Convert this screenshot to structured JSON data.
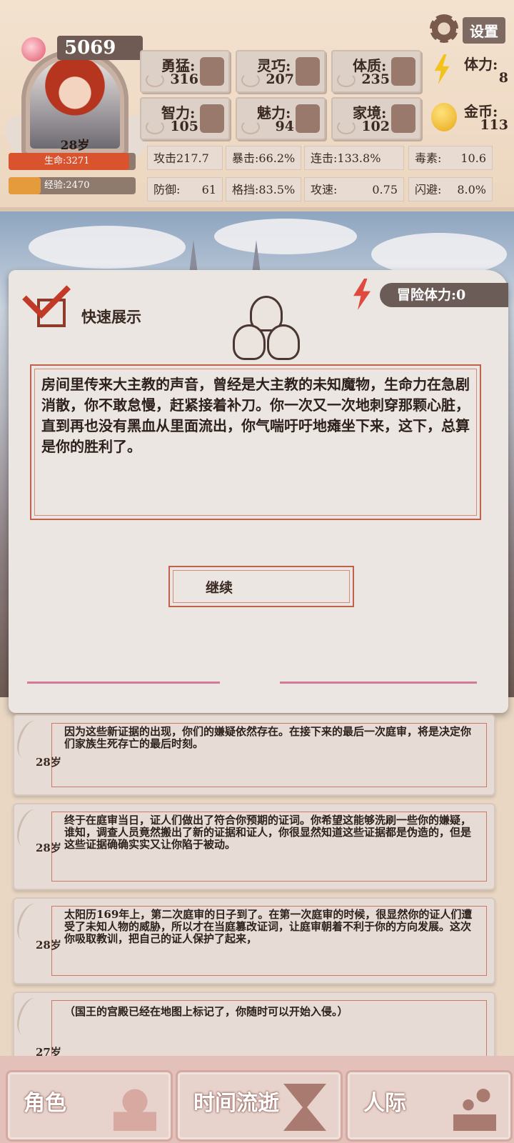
{
  "header": {
    "soul_points": "5069",
    "age": "28岁",
    "hp_label": "生命:3271",
    "hp_fraction": 0.95,
    "xp_label": "经验:2470",
    "xp_fraction": 0.25,
    "settings_label": "设置",
    "stats": [
      {
        "name": "勇猛:",
        "value": "316",
        "icon": "fist-icon"
      },
      {
        "name": "灵巧:",
        "value": "207",
        "icon": "boot-icon"
      },
      {
        "name": "体质:",
        "value": "235",
        "icon": "muscle-arm-icon"
      },
      {
        "name": "智力:",
        "value": "105",
        "icon": "brain-icon"
      },
      {
        "name": "魅力:",
        "value": "94",
        "icon": "flower-icon"
      },
      {
        "name": "家境:",
        "value": "102",
        "icon": "family-icon"
      }
    ],
    "resources": [
      {
        "name": "体力:",
        "value": "8",
        "icon": "lightning-icon"
      },
      {
        "name": "金币:",
        "value": "113",
        "icon": "gold-coin-icon"
      }
    ],
    "combat": [
      {
        "label": "攻击217.7",
        "value": ""
      },
      {
        "label": "暴击:66.2%",
        "value": ""
      },
      {
        "label": "连击:133.8%",
        "value": ""
      },
      {
        "label": "毒素:",
        "value": "10.6"
      },
      {
        "label": "防御:",
        "value": "61"
      },
      {
        "label": "格挡:83.5%",
        "value": ""
      },
      {
        "label": "攻速:",
        "value": "0.75"
      },
      {
        "label": "闪避:",
        "value": "8.0%"
      }
    ]
  },
  "panel": {
    "stamina_label": "冒险体力:0",
    "quick_show_label": "快速展示",
    "story": "房间里传来大主教的声音，曾经是大主教的未知魔物，生命力在急剧消散，你不敢怠慢，赶紧接着补刀。你一次又一次地刺穿那颗心脏，直到再也没有黑血从里面流出，你气喘吁吁地瘫坐下来，这下，总算是你的胜利了。",
    "continue_label": "继续"
  },
  "log": [
    {
      "age": "28岁",
      "text": "因为这些新证据的出现，你们的嫌疑依然存在。在接下来的最后一次庭审，将是决定你们家族生死存亡的最后时刻。"
    },
    {
      "age": "28岁",
      "text": "终于在庭审当日，证人们做出了符合你预期的证词。你希望这能够洗刷一些你的嫌疑，谁知，调查人员竟然搬出了新的证据和证人，你很显然知道这些证据都是伪造的，但是这些证据确确实实又让你陷于被动。"
    },
    {
      "age": "28岁",
      "text": "太阳历169年上，第二次庭审的日子到了。在第一次庭审的时候，很显然你的证人们遭受了未知人物的威胁，所以才在当庭篡改证词，让庭审朝着不利于你的方向发展。这次你吸取教训，把自己的证人保护了起来，"
    },
    {
      "age": "27岁",
      "text": "（国王的宫殿已经在地图上标记了，你随时可以开始入侵。）"
    }
  ],
  "nav": [
    {
      "label": "角色",
      "icon": "character-bust-icon"
    },
    {
      "label": "时间流逝",
      "icon": "hourglass-icon"
    },
    {
      "label": "人际",
      "icon": "chess-pawns-icon"
    }
  ]
}
